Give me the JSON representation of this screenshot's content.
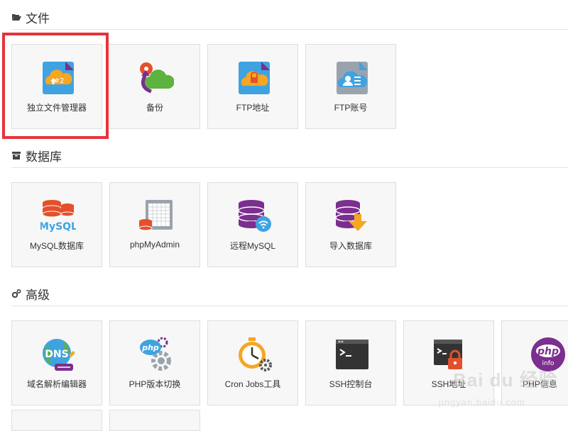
{
  "sections": [
    {
      "title": "文件",
      "icon": "folder-open-icon"
    },
    {
      "title": "数据库",
      "icon": "archive-icon"
    },
    {
      "title": "高级",
      "icon": "gears-icon"
    }
  ],
  "tiles": [
    {
      "label": "独立文件管理器",
      "icon": "file-manager-icon"
    },
    {
      "label": "备份",
      "icon": "backup-icon"
    },
    {
      "label": "FTP地址",
      "icon": "ftp-address-icon"
    },
    {
      "label": "FTP账号",
      "icon": "ftp-account-icon"
    },
    {
      "label": "MySQL数据库",
      "icon": "mysql-icon"
    },
    {
      "label": "phpMyAdmin",
      "icon": "phpmyadmin-icon"
    },
    {
      "label": "远程MySQL",
      "icon": "remote-mysql-icon"
    },
    {
      "label": "导入数据库",
      "icon": "import-database-icon"
    },
    {
      "label": "域名解析编辑器",
      "icon": "dns-editor-icon"
    },
    {
      "label": "PHP版本切换",
      "icon": "php-version-icon"
    },
    {
      "label": "Cron Jobs工具",
      "icon": "cron-jobs-icon"
    },
    {
      "label": "SSH控制台",
      "icon": "ssh-console-icon"
    },
    {
      "label": "SSH地址",
      "icon": "ssh-address-icon"
    },
    {
      "label": "PHP信息",
      "icon": "php-info-icon"
    }
  ],
  "icon_text": {
    "mysql": "MySQL",
    "dns": "DNS",
    "php": "php",
    "php_info": "info",
    "file_num": "#2"
  },
  "watermark": {
    "main": "Bai du 经验",
    "sub": "jingyan.baidu.com"
  },
  "colors": {
    "highlight": "#e8323a",
    "tile_bg": "#f7f7f7",
    "tile_border": "#dedede",
    "purple": "#7b2f8e",
    "blue": "#3ea3e0",
    "orange": "#f5a623",
    "red": "#e4502c",
    "green": "#5db340"
  }
}
